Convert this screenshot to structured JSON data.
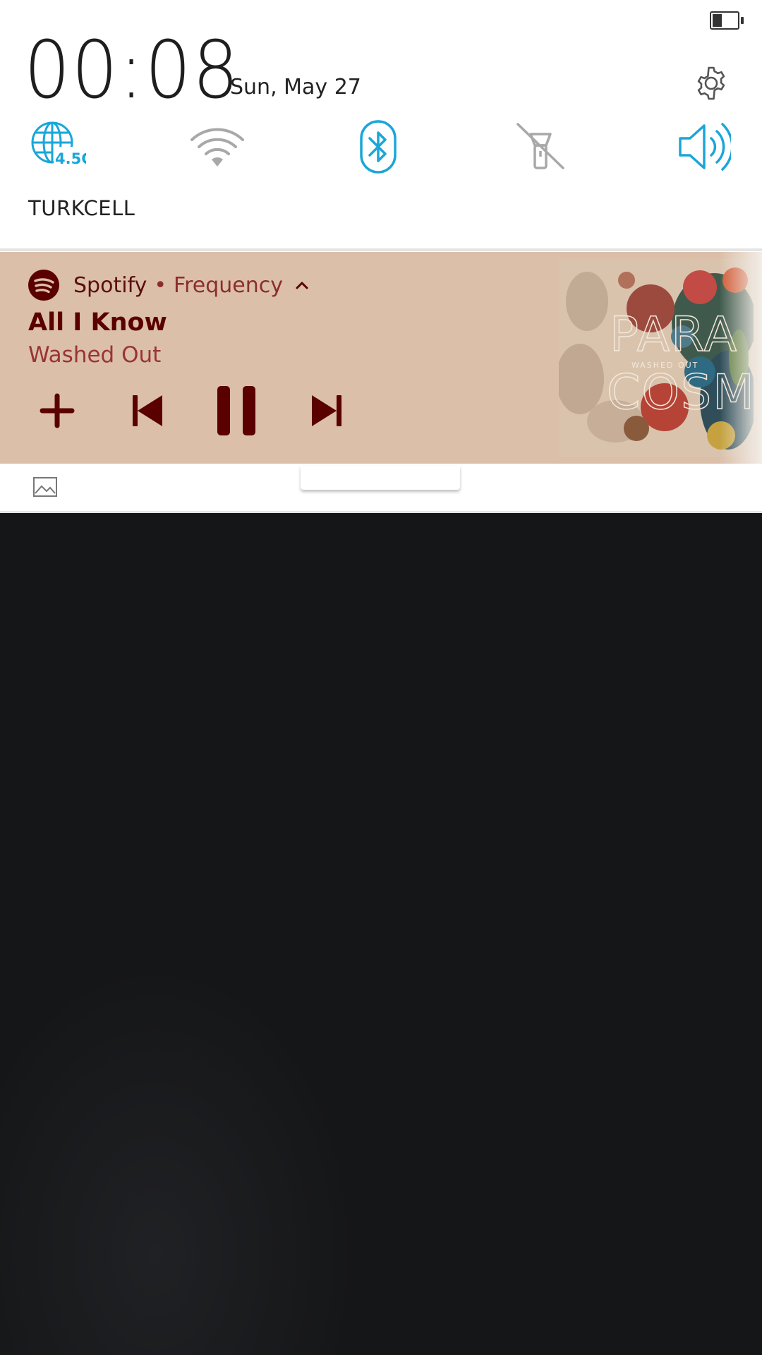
{
  "status_bar": {
    "battery_icon": "battery-low-icon"
  },
  "header": {
    "time": "00:08",
    "date": "Sun, May 27",
    "settings_icon": "gear-icon"
  },
  "quick_settings": [
    {
      "name": "mobile-data",
      "icon": "globe-4-5g-icon",
      "badge": "4.5G",
      "active": true
    },
    {
      "name": "wifi",
      "icon": "wifi-icon",
      "active": false
    },
    {
      "name": "bluetooth",
      "icon": "bluetooth-icon",
      "active": true
    },
    {
      "name": "flashlight",
      "icon": "flashlight-off-icon",
      "active": false
    },
    {
      "name": "sound",
      "icon": "speaker-icon",
      "active": true
    }
  ],
  "carrier": "TURKCELL",
  "media": {
    "app": "Spotify",
    "separator": "•",
    "playlist": "Frequency",
    "track_title": "All I Know",
    "artist": "Washed Out",
    "album_art_text": {
      "line1": "PARA",
      "line2": "WASHED OUT",
      "line3": "COSM"
    },
    "controls": [
      "add-icon",
      "previous-icon",
      "pause-icon",
      "next-icon"
    ]
  },
  "colors": {
    "accent": "#1aa6d9",
    "inactive": "#a8a8a8",
    "media_bg": "#dbbfa9",
    "media_text_dark": "#5a0000",
    "media_text_light": "#9a3434"
  }
}
